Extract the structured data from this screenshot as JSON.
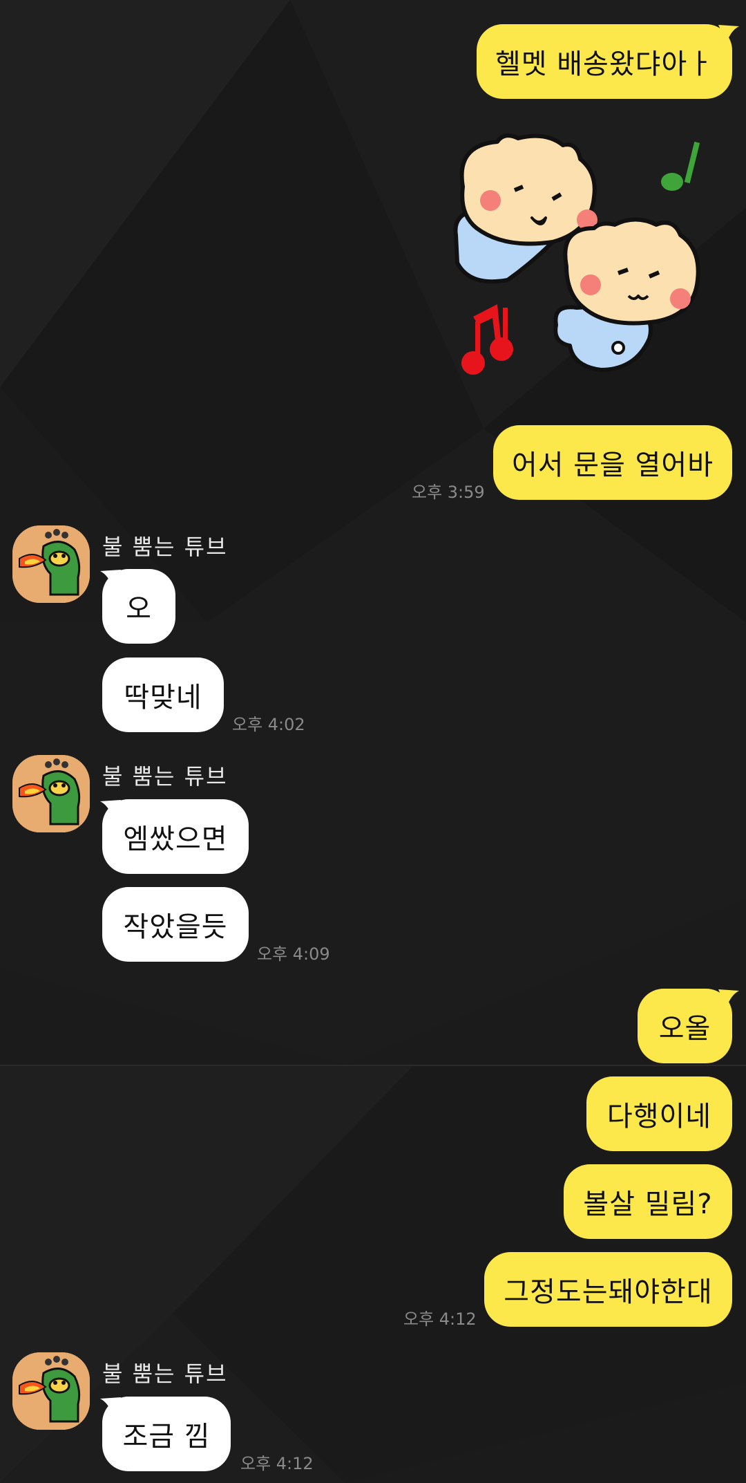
{
  "chat": {
    "friend_name": "불 뿜는 튜브",
    "messages": {
      "m1": "헬멧 배송왔댜아ㅏ",
      "m2": "어서 문을 열어바",
      "m3": "오",
      "m4": "딱맞네",
      "m5": "엠쌌으면",
      "m6": "작았을듯",
      "m7": "오올",
      "m8": "다행이네",
      "m9": "볼살 밀림?",
      "m10": "그정도는돼야한대",
      "m11": "조금 낌"
    },
    "times": {
      "t1": "오후 3:59",
      "t2": "오후 4:02",
      "t3": "오후 4:09",
      "t4": "오후 4:12",
      "t5": "오후 4:12"
    }
  },
  "colors": {
    "background": "#1b1b1b",
    "my_bubble": "#fde84b",
    "their_bubble": "#ffffff",
    "time_text": "#8a8a8a"
  },
  "icons": {
    "sticker": "two-bears-music-sticker",
    "avatar": "fire-breathing-tube-avatar"
  }
}
